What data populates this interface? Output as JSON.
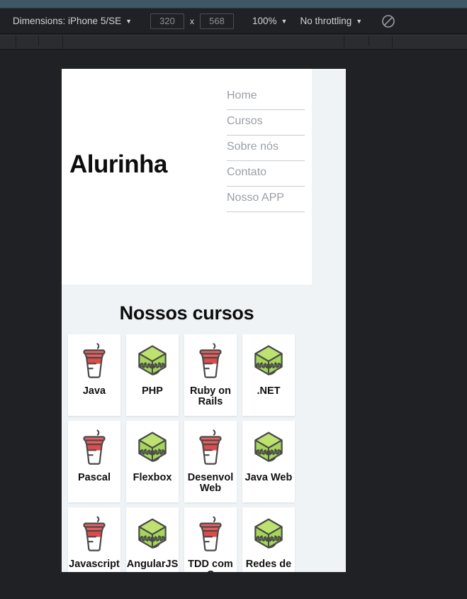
{
  "devtools": {
    "dimensions_label": "Dimensions: iPhone 5/SE",
    "width_value": "320",
    "height_value": "568",
    "multiply_symbol": "x",
    "zoom_label": "100%",
    "throttling_label": "No throttling",
    "rotate_icon": "rotate-device-icon",
    "caret": "▼",
    "toolbar_bg": "#202124",
    "title_bg": "#3f5665"
  },
  "ruler": {
    "ticks_left": [
      22,
      54,
      88
    ],
    "ticks_right": [
      485,
      520,
      553
    ]
  },
  "page": {
    "brand": "Alurinha",
    "nav": [
      {
        "label": "Home"
      },
      {
        "label": "Cursos"
      },
      {
        "label": "Sobre nós"
      },
      {
        "label": "Contato"
      },
      {
        "label": "Nosso APP"
      }
    ],
    "section_title": "Nossos cursos",
    "bg_color": "#eff3f6",
    "cards": [
      {
        "label": "Java",
        "icon": "coffee-cup-icon"
      },
      {
        "label": "PHP",
        "icon": "green-box-icon"
      },
      {
        "label": "Ruby on Rails",
        "icon": "coffee-cup-icon"
      },
      {
        "label": ".NET",
        "icon": "green-box-icon"
      },
      {
        "label": "Pascal",
        "icon": "coffee-cup-icon"
      },
      {
        "label": "Flexbox",
        "icon": "green-box-icon"
      },
      {
        "label": "Desenvol Web",
        "icon": "coffee-cup-icon"
      },
      {
        "label": "Java Web",
        "icon": "green-box-icon"
      },
      {
        "label": "Javascript",
        "icon": "coffee-cup-icon"
      },
      {
        "label": "AngularJS",
        "icon": "green-box-icon"
      },
      {
        "label": "TDD com C",
        "icon": "coffee-cup-icon"
      },
      {
        "label": "Redes de",
        "icon": "green-box-icon"
      }
    ]
  }
}
